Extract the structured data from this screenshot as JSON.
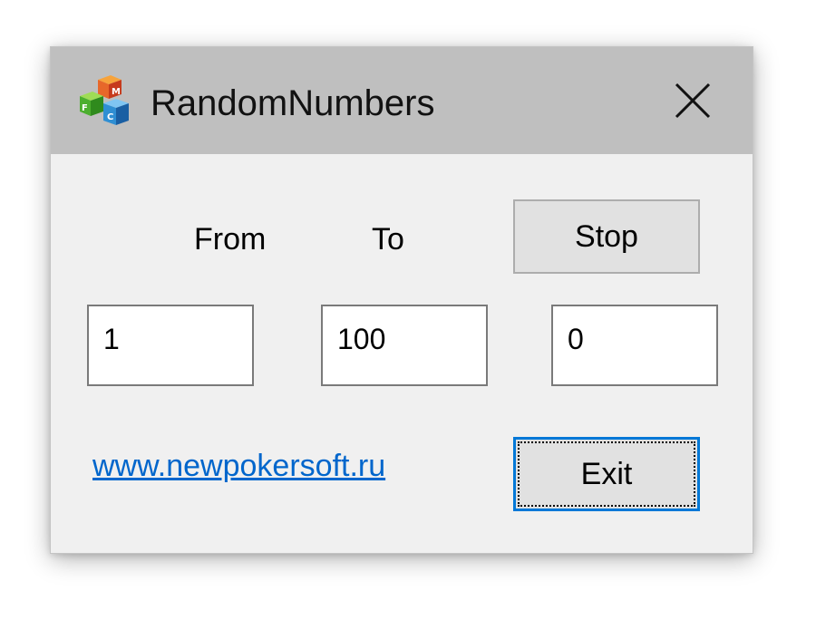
{
  "window": {
    "title": "RandomNumbers",
    "icon": "app-cubes-icon",
    "close_icon": "close-icon"
  },
  "labels": {
    "from": "From",
    "to": "To"
  },
  "buttons": {
    "stop": "Stop",
    "exit": "Exit"
  },
  "fields": {
    "from_value": "1",
    "to_value": "100",
    "result_value": "0"
  },
  "link": {
    "text": "www.newpokersoft.ru"
  },
  "colors": {
    "titlebar": "#bfbfbf",
    "window_bg": "#f0f0f0",
    "link": "#0066cc",
    "focus_border": "#0078d7"
  }
}
